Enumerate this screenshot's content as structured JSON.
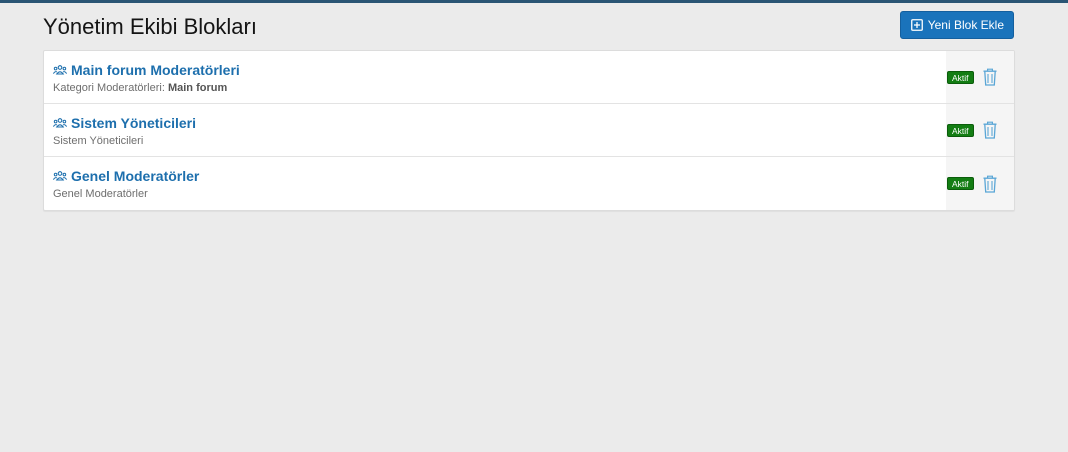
{
  "header": {
    "title": "Yönetim Ekibi Blokları",
    "add_button_label": "Yeni Blok Ekle"
  },
  "blocks": [
    {
      "title": "Main forum Moderatörleri",
      "description_prefix": "Kategori Moderatörleri:",
      "description_bold": "Main forum",
      "status": "Aktif"
    },
    {
      "title": "Sistem Yöneticileri",
      "description_prefix": "Sistem Yöneticileri",
      "description_bold": "",
      "status": "Aktif"
    },
    {
      "title": "Genel Moderatörler",
      "description_prefix": "Genel Moderatörler",
      "description_bold": "",
      "status": "Aktif"
    }
  ],
  "colors": {
    "accent": "#1a73bb",
    "title_link": "#1d6fad",
    "status_active": "#137d13",
    "delete_icon": "#5aa6d6"
  },
  "icons": {
    "add": "plus-square-icon",
    "group": "users-icon",
    "delete": "trash-icon"
  }
}
